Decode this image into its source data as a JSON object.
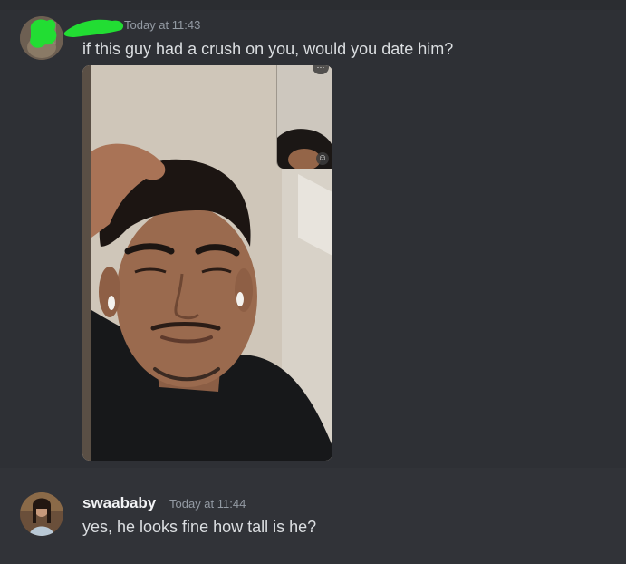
{
  "messages": [
    {
      "username": "",
      "timestamp": "Today at 11:43",
      "content": "if this guy had a crush on you, would you date him?",
      "attachment": {
        "type": "image",
        "pip_badge_icon": "smiley-icon",
        "more_badge_text": "···"
      }
    },
    {
      "username": "swaababy",
      "timestamp": "Today at 11:44",
      "content": "yes, he looks fine how tall is he?"
    }
  ],
  "colors": {
    "background": "#313338",
    "username": "#f2f3f5",
    "message_text": "#dbdee1",
    "timestamp": "#949ba4",
    "redaction_scribble": "#22dd33"
  }
}
